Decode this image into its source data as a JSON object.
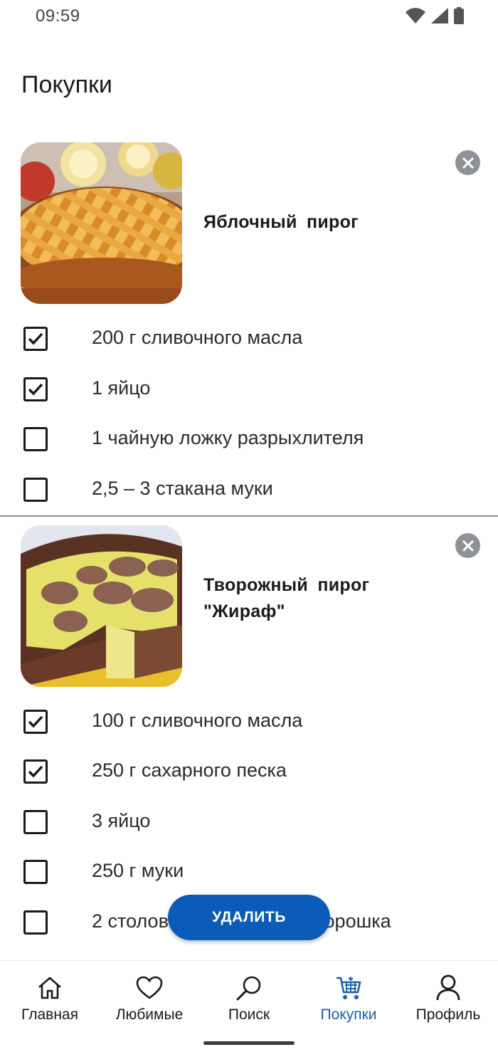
{
  "status_bar": {
    "time": "09:59"
  },
  "page": {
    "title": "Покупки"
  },
  "recipes": [
    {
      "name": "Яблочный  пирог",
      "ingredients": [
        {
          "text": "200 г сливочного масла",
          "checked": true
        },
        {
          "text": "1 яйцо",
          "checked": true
        },
        {
          "text": "1 чайную ложку разрыхлителя",
          "checked": false
        },
        {
          "text": "2,5 – 3 стакана муки",
          "checked": false
        }
      ]
    },
    {
      "name_line1": "Творожный  пирог",
      "name_line2": "\"Жираф\"",
      "ingredients": [
        {
          "text": "100 г сливочного масла",
          "checked": true
        },
        {
          "text": "250 г сахарного песка",
          "checked": true
        },
        {
          "text": "3 яйцо",
          "checked": false
        },
        {
          "text": "250 г муки",
          "checked": false
        },
        {
          "text": "2 столовые ложки какао-порошка",
          "checked": false
        }
      ]
    }
  ],
  "actions": {
    "delete_label": "УДАЛИТЬ"
  },
  "bottom_nav": [
    {
      "label": "Главная",
      "icon": "home-icon",
      "active": false
    },
    {
      "label": "Любимые",
      "icon": "heart-icon",
      "active": false
    },
    {
      "label": "Поиск",
      "icon": "search-icon",
      "active": false
    },
    {
      "label": "Покупки",
      "icon": "cart-icon",
      "active": true
    },
    {
      "label": "Профиль",
      "icon": "person-icon",
      "active": false
    }
  ],
  "colors": {
    "accent": "#0a5cb8",
    "active_nav": "#1e5fa8",
    "remove_button": "#8e9296"
  }
}
